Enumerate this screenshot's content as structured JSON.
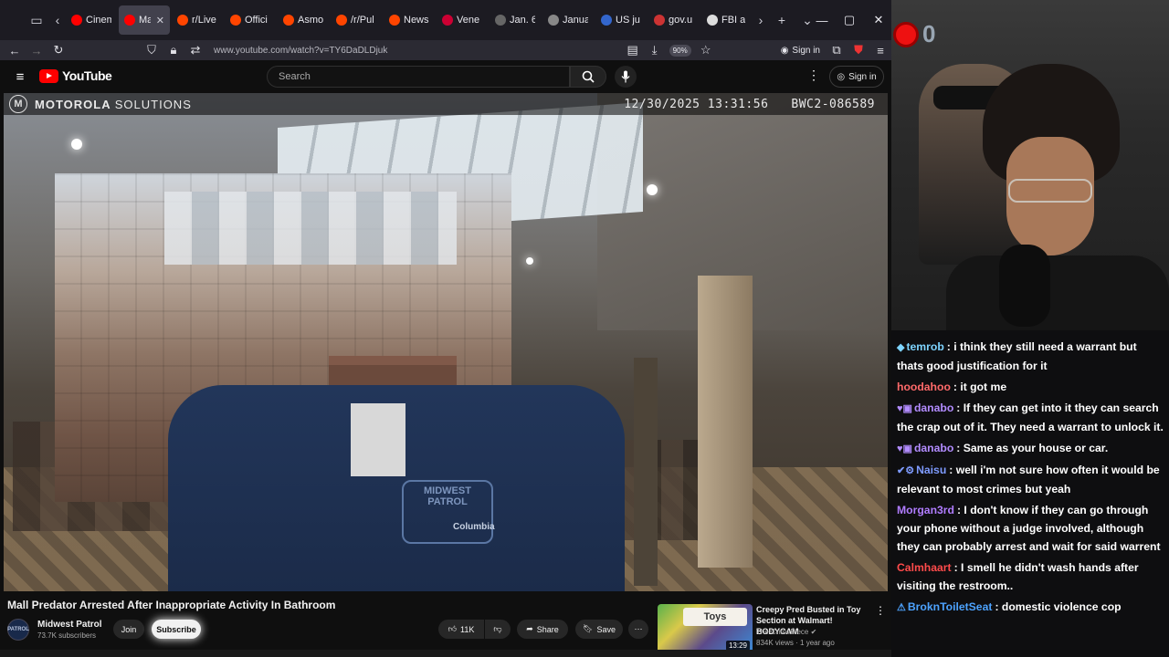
{
  "browser": {
    "tabs": [
      {
        "label": "Cinem",
        "favicon_color": "#ff0000",
        "active": false
      },
      {
        "label": "Ma",
        "favicon_color": "#ff0000",
        "active": true
      },
      {
        "label": "r/Live",
        "favicon_color": "#ff4500",
        "active": false
      },
      {
        "label": "Offici",
        "favicon_color": "#ff4500",
        "active": false
      },
      {
        "label": "Asmo",
        "favicon_color": "#ff4500",
        "active": false
      },
      {
        "label": "/r/Pul",
        "favicon_color": "#ff4500",
        "active": false
      },
      {
        "label": "News",
        "favicon_color": "#ff4500",
        "active": false
      },
      {
        "label": "Vene",
        "favicon_color": "#cc0033",
        "active": false
      },
      {
        "label": "Jan. 6",
        "favicon_color": "#666666",
        "active": false
      },
      {
        "label": "Janua",
        "favicon_color": "#888888",
        "active": false
      },
      {
        "label": "US ju",
        "favicon_color": "#3366cc",
        "active": false
      },
      {
        "label": "gov.u",
        "favicon_color": "#cc3333",
        "active": false
      },
      {
        "label": "FBI a",
        "favicon_color": "#dddddd",
        "active": false
      }
    ],
    "url": "www.youtube.com/watch?v=TY6DaDLDjuk",
    "zoom": "90%",
    "signin_label": "Sign in"
  },
  "youtube": {
    "logo_text": "YouTube",
    "search_placeholder": "Search",
    "signin_label": "Sign in",
    "bodycam": {
      "brand_bold": "MOTOROLA",
      "brand_thin": "SOLUTIONS",
      "timestamp": "12/30/2025 13:31:56",
      "device_id": "BWC2-086589",
      "patch_text": "MIDWEST PATROL",
      "patch_brand": "Columbia"
    },
    "video_title": "Mall Predator Arrested After Inappropriate Activity In Bathroom",
    "channel": {
      "name": "Midwest Patrol",
      "subscribers": "73.7K subscribers",
      "avatar_text": "PATROL"
    },
    "buttons": {
      "join": "Join",
      "subscribe": "Subscribe",
      "likes": "11K",
      "share": "Share",
      "save": "Save"
    },
    "recommended": {
      "title": "Creepy Pred Busted in Toy Section at Walmart! BODYCAM",
      "channel": "The CrimePiece",
      "meta": "834K views · 1 year ago",
      "duration": "13:29",
      "thumb_text": "Toys"
    }
  },
  "stream": {
    "overlay_count": "0",
    "chat": [
      {
        "badges": "◆",
        "user": "temrob",
        "color": "#7ed4ff",
        "text": ": i think they still need a warrant but thats good justification for it"
      },
      {
        "badges": "",
        "user": "hoodahoo",
        "color": "#ff6a6a",
        "text": ": it got me"
      },
      {
        "badges": "♥▣",
        "user": "danabo",
        "color": "#b28cff",
        "text": ": If they can get into it they can search the crap out of it. They need a warrant to unlock it."
      },
      {
        "badges": "♥▣",
        "user": "danabo",
        "color": "#b28cff",
        "text": ": Same as your house or car."
      },
      {
        "badges": "✔⚙",
        "user": "Naisu",
        "color": "#7e9bff",
        "text": ": well i'm not sure how often it would be relevant to most crimes but yeah"
      },
      {
        "badges": "",
        "user": "Morgan3rd",
        "color": "#b07cff",
        "text": ": I don't know if they can go through your phone without a judge involved, although they can probably arrest and wait for said warrent"
      },
      {
        "badges": "",
        "user": "Calmhaart",
        "color": "#ff4b4b",
        "text": ": I smell he didn't wash hands after visiting the restroom.."
      },
      {
        "badges": "⚠",
        "user": "BroknToiletSeat",
        "color": "#4da3ff",
        "text": ": domestic violence cop"
      }
    ]
  }
}
